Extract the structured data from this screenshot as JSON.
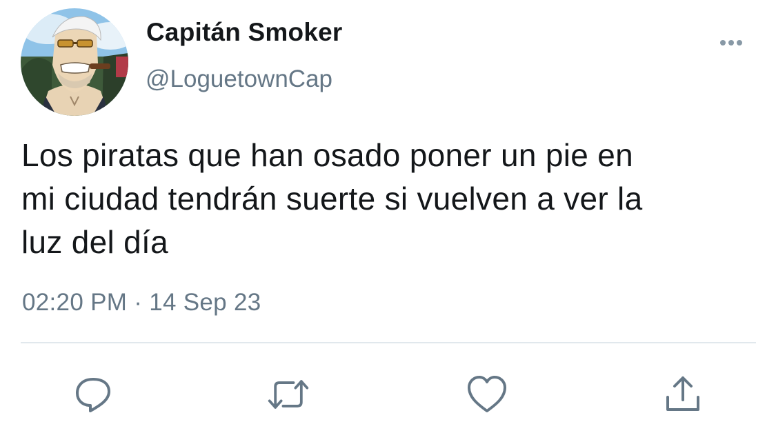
{
  "user": {
    "display_name": "Capitán Smoker",
    "handle": "@LoguetownCap"
  },
  "tweet": {
    "text_lines": [
      "Los piratas que han osado poner un pie en",
      "mi ciudad tendrán suerte si vuelven a ver la",
      "luz del día"
    ],
    "time": "02:20 PM",
    "separator": "·",
    "date": "14 Sep 23"
  },
  "actions": {
    "reply_icon": "reply-icon",
    "retweet_icon": "retweet-icon",
    "like_icon": "heart-icon",
    "share_icon": "share-icon",
    "more_icon": "more-icon"
  },
  "colors": {
    "text": "#14171a",
    "secondary": "#657786",
    "divider": "#e1e8ed",
    "background": "#ffffff"
  }
}
